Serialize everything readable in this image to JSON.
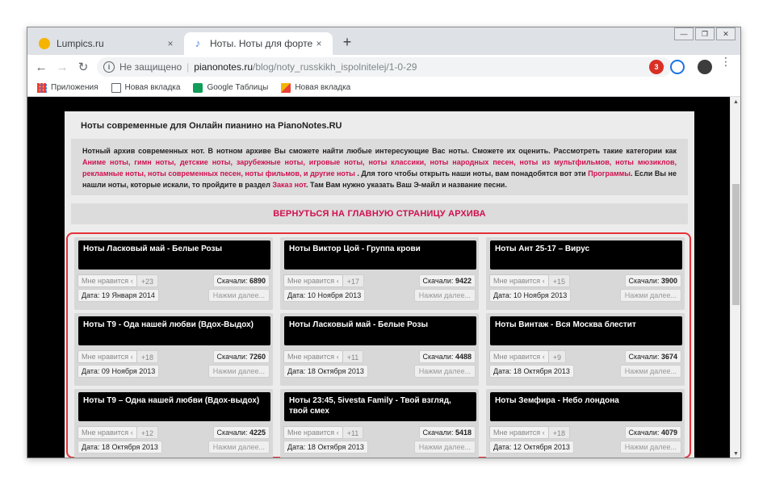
{
  "browser": {
    "tabs": [
      {
        "title": "Lumpics.ru",
        "close": "×"
      },
      {
        "title": "Ноты. Ноты для фортепиано. Н",
        "close": "×"
      }
    ],
    "new_tab": "+",
    "window_controls": [
      "—",
      "❐",
      "✕"
    ],
    "nav": {
      "back": "←",
      "forward": "→",
      "reload": "↻"
    },
    "omnibox": {
      "info": "i",
      "security": "Не защищено",
      "separator": "|",
      "domain": "pianonotes.ru",
      "path": "/blog/noty_russkikh_ispolnitelej/1-0-29",
      "star": "☆"
    },
    "ext_badge": "3",
    "menu": "⋮"
  },
  "bookmarks": [
    {
      "label": "Приложения",
      "icon": "apps-icon"
    },
    {
      "label": "Новая вкладка",
      "icon": "page-icon"
    },
    {
      "label": "Google Таблицы",
      "icon": "sheets-icon"
    },
    {
      "label": "Новая вкладка",
      "icon": "image-icon"
    }
  ],
  "page": {
    "title": "Ноты современные для Онлайн пианино на PianoNotes.RU",
    "intro": {
      "p1": "Нотный архив современных нот. В нотном архиве Вы сможете найти любые интересующие Вас ноты. Сможете их оценить. Рассмотреть такие категории как ",
      "links1": "Аниме ноты, гимн ноты, детские ноты, зарубежные ноты, игровые ноты, ноты классики, ноты народных песен, ноты из мультфильмов, ноты мюзиклов, рекламные ноты, ноты современных песен, ноты фильмов, и другие ноты",
      "p2": " . Для того чтобы открыть наши ноты, вам понадобятся вот эти ",
      "link2": "Программы",
      "p3": ". Если Вы не нашли ноты, которые искали, то пройдите в раздел ",
      "link3": "Заказ нот",
      "p4": ". Там Вам нужно указать Ваш Э-майл и название песни."
    },
    "back_link": "ВЕРНУТЬСЯ НА ГЛАВНУЮ СТРАНИЦУ АРХИВА",
    "like_label": "Мне нравится",
    "dl_label": "Скачали:",
    "more_label": "Нажми далее...",
    "cards": [
      {
        "title": "Ноты Ласковый май - Белые Розы",
        "likes": "+23",
        "downloads": "6890",
        "date": "Дата: 19 Января 2014"
      },
      {
        "title": "Ноты Виктор Цой - Группа крови",
        "likes": "+17",
        "downloads": "9422",
        "date": "Дата: 10 Ноября 2013"
      },
      {
        "title": "Ноты Ант 25-17 – Вирус",
        "likes": "+15",
        "downloads": "3900",
        "date": "Дата: 10 Ноября 2013"
      },
      {
        "title": "Ноты T9 - Ода нашей любви (Вдох-Выдох)",
        "likes": "+18",
        "downloads": "7260",
        "date": "Дата: 09 Ноября 2013"
      },
      {
        "title": "Ноты Ласковый май - Белые Розы",
        "likes": "+11",
        "downloads": "4488",
        "date": "Дата: 18 Октября 2013"
      },
      {
        "title": "Ноты Винтаж - Вся Москва блестит",
        "likes": "+9",
        "downloads": "3674",
        "date": "Дата: 18 Октября 2013"
      },
      {
        "title": "Ноты T9 – Одна нашей любви (Вдох-выдох)",
        "likes": "+12",
        "downloads": "4225",
        "date": "Дата: 18 Октября 2013"
      },
      {
        "title": "Ноты 23:45, 5ivesta Family - Твой взгляд, твой смех",
        "likes": "+11",
        "downloads": "5418",
        "date": "Дата: 18 Октября 2013"
      },
      {
        "title": "Ноты Земфира - Небо лондона",
        "likes": "+18",
        "downloads": "4079",
        "date": "Дата: 12 Октября 2013"
      }
    ]
  },
  "scrollbar": {
    "up": "▲",
    "down": "▼"
  },
  "colors": {
    "accent_link": "#d0104f",
    "highlight_border": "#e53238"
  }
}
